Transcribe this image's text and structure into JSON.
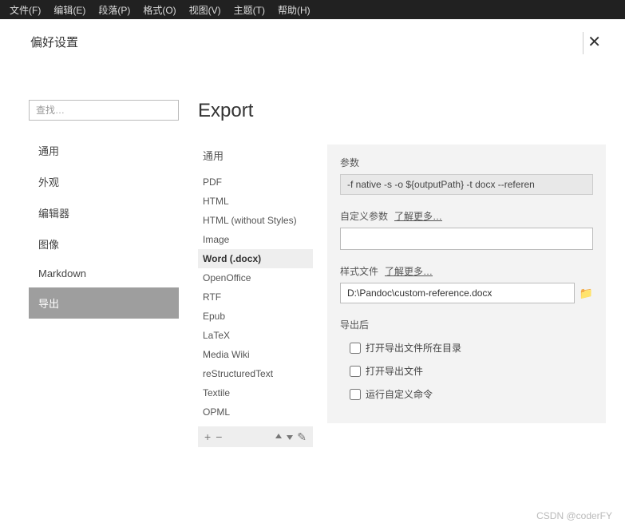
{
  "menubar": [
    "文件(F)",
    "编辑(E)",
    "段落(P)",
    "格式(O)",
    "视图(V)",
    "主题(T)",
    "帮助(H)"
  ],
  "header": {
    "title": "偏好设置"
  },
  "search": {
    "placeholder": "查找…"
  },
  "nav": {
    "items": [
      "通用",
      "外观",
      "编辑器",
      "图像",
      "Markdown",
      "导出"
    ],
    "active": 5
  },
  "main": {
    "title": "Export"
  },
  "formats": {
    "header": "通用",
    "items": [
      "PDF",
      "HTML",
      "HTML (without Styles)",
      "Image",
      "Word (.docx)",
      "OpenOffice",
      "RTF",
      "Epub",
      "LaTeX",
      "Media Wiki",
      "reStructuredText",
      "Textile",
      "OPML"
    ],
    "active": 4
  },
  "settings": {
    "param_label": "参数",
    "param_value": "-f native -s -o ${outputPath} -t docx --referen",
    "custom_label": "自定义参数",
    "learn_more": "了解更多…",
    "custom_value": "",
    "style_label": "样式文件",
    "style_value": "D:\\Pandoc\\custom-reference.docx",
    "after_label": "导出后",
    "checkboxes": [
      {
        "label": "打开导出文件所在目录",
        "checked": false
      },
      {
        "label": "打开导出文件",
        "checked": false
      },
      {
        "label": "运行自定义命令",
        "checked": false
      }
    ]
  },
  "watermark": "CSDN @coderFY"
}
